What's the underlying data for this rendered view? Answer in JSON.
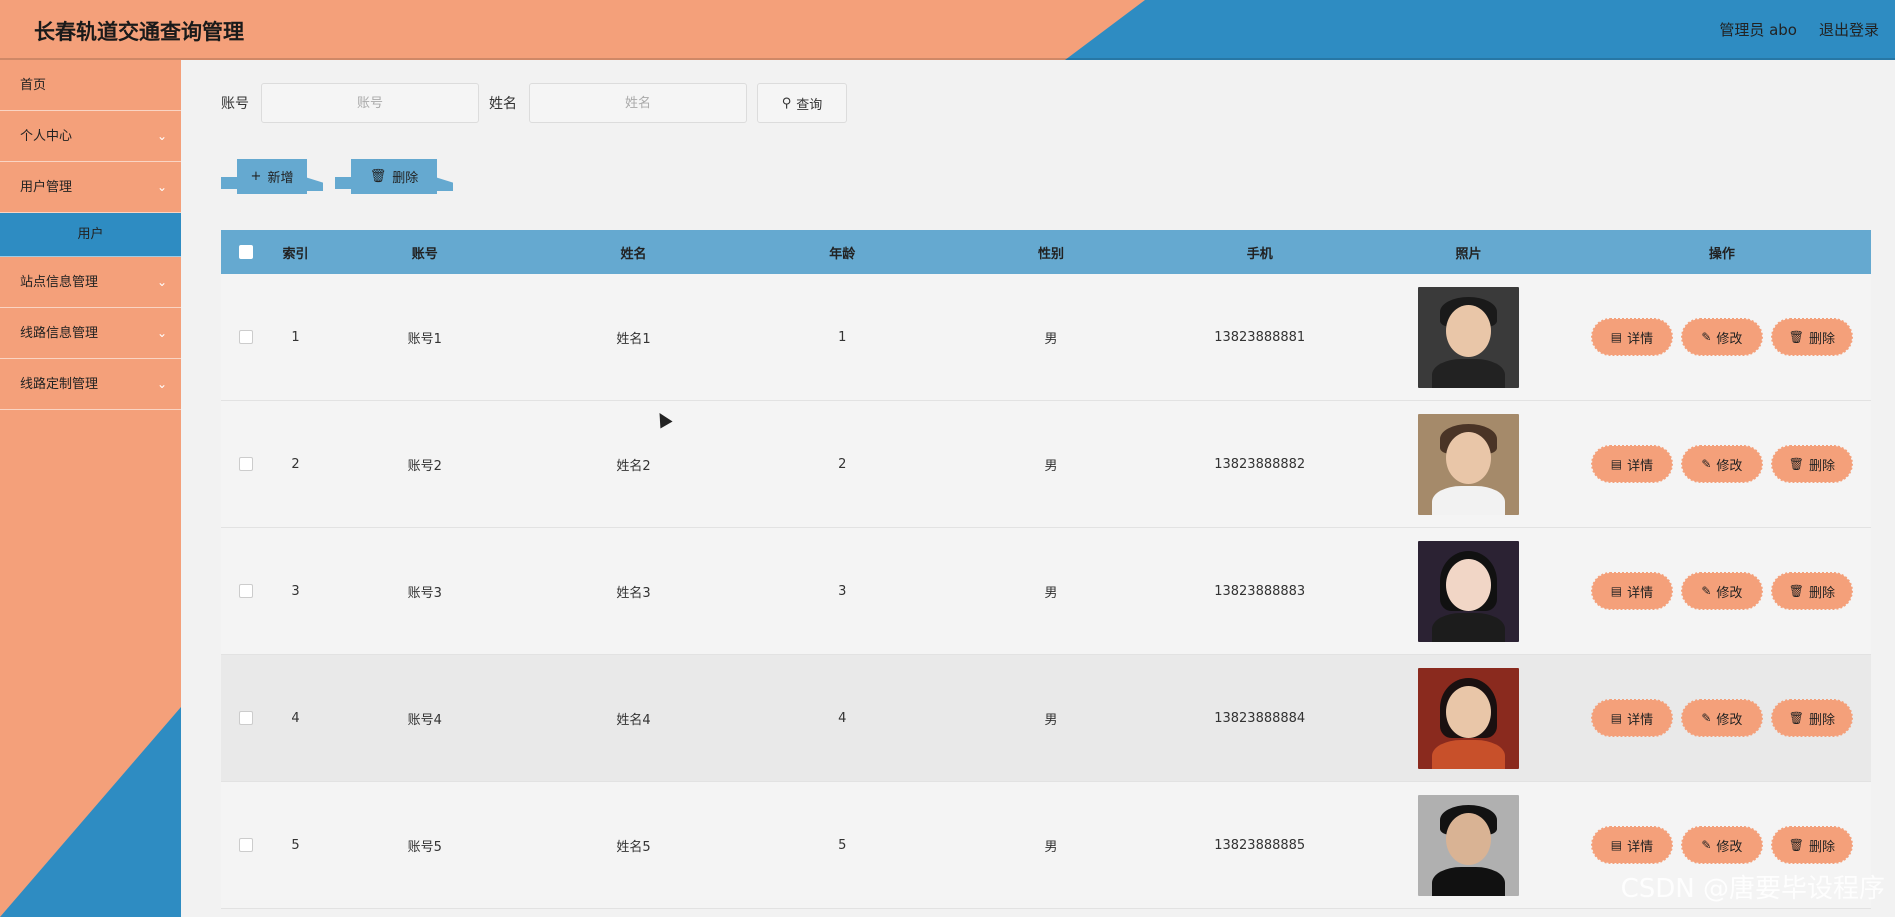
{
  "header": {
    "title": "长春轨道交通查询管理",
    "user": "管理员 abo",
    "logout": "退出登录"
  },
  "sidebar": {
    "items": [
      {
        "label": "首页",
        "chevron": false
      },
      {
        "label": "个人中心",
        "chevron": true
      },
      {
        "label": "用户管理",
        "chevron": true
      },
      {
        "label": "用户",
        "sub": true
      },
      {
        "label": "站点信息管理",
        "chevron": true
      },
      {
        "label": "线路信息管理",
        "chevron": true
      },
      {
        "label": "线路定制管理",
        "chevron": true
      }
    ]
  },
  "search": {
    "account_label": "账号",
    "account_placeholder": "账号",
    "name_label": "姓名",
    "name_placeholder": "姓名",
    "query_button": "查询"
  },
  "actions": {
    "add": "新增",
    "delete": "删除"
  },
  "table": {
    "columns": [
      "索引",
      "账号",
      "姓名",
      "年龄",
      "性别",
      "手机",
      "照片",
      "操作"
    ],
    "ops": {
      "detail": "详情",
      "edit": "修改",
      "delete": "删除"
    },
    "rows": [
      {
        "index": "1",
        "account": "账号1",
        "name": "姓名1",
        "age": "1",
        "sex": "男",
        "phone": "13823888881"
      },
      {
        "index": "2",
        "account": "账号2",
        "name": "姓名2",
        "age": "2",
        "sex": "男",
        "phone": "13823888882"
      },
      {
        "index": "3",
        "account": "账号3",
        "name": "姓名3",
        "age": "3",
        "sex": "男",
        "phone": "13823888883"
      },
      {
        "index": "4",
        "account": "账号4",
        "name": "姓名4",
        "age": "4",
        "sex": "男",
        "phone": "13823888884"
      },
      {
        "index": "5",
        "account": "账号5",
        "name": "姓名5",
        "age": "5",
        "sex": "男",
        "phone": "13823888885"
      }
    ]
  },
  "watermark": "CSDN @唐要毕设程序",
  "colors": {
    "orange": "#f4a07a",
    "blue": "#2e8cc2",
    "table_header": "#65a9d0"
  }
}
